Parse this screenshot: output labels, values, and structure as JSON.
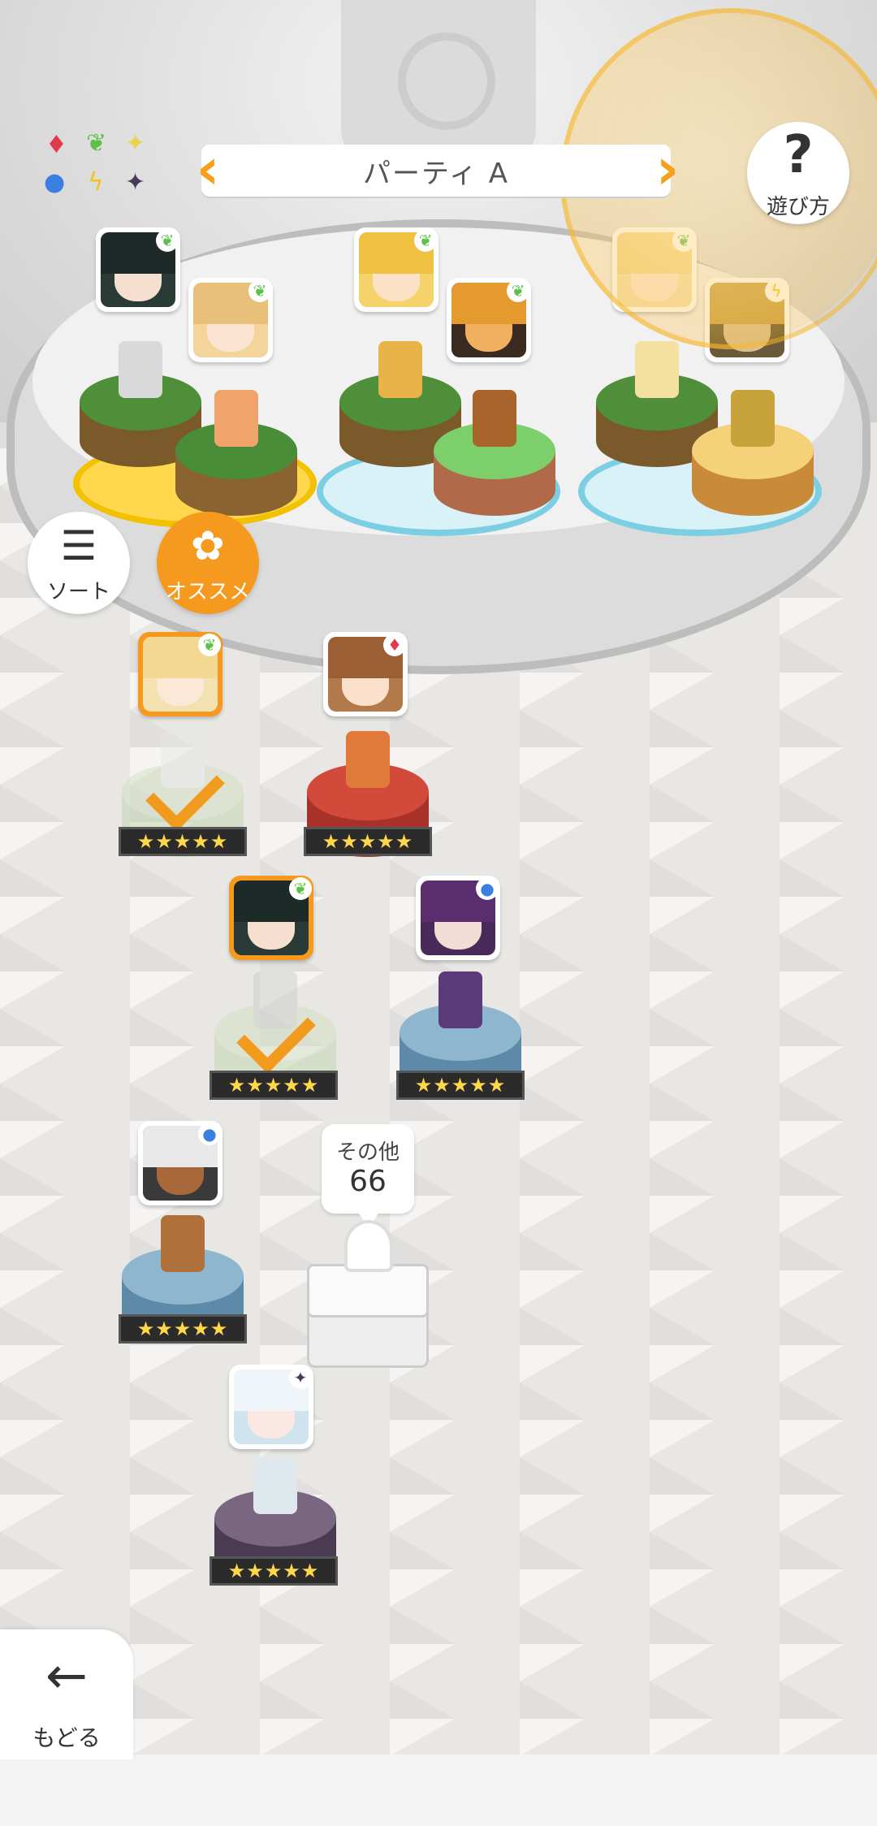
{
  "header": {
    "party_name": "パーティ A",
    "prev_icon": "chevron-left-icon",
    "next_icon": "chevron-right-icon",
    "help_label": "遊び方",
    "help_icon": "question-icon"
  },
  "attribute_chart": {
    "icons": [
      "fire-diamond",
      "wind-leaf",
      "light-sparkle",
      "water-circle",
      "thunder-bolt",
      "dark-star"
    ]
  },
  "side_buttons": {
    "sort_label": "ソート",
    "recommend_label": "オススメ"
  },
  "party_slots": [
    {
      "attrs": [
        "wind",
        "wind"
      ]
    },
    {
      "attrs": [
        "wind",
        "wind"
      ]
    },
    {
      "attrs": [
        "wind",
        "thunder"
      ]
    }
  ],
  "roster": [
    {
      "attr": "wind",
      "selected": true,
      "rarity": "★★★★★"
    },
    {
      "attr": "fire",
      "selected": false,
      "rarity": "★★★★★"
    },
    {
      "attr": "wind",
      "selected": true,
      "rarity": "★★★★★"
    },
    {
      "attr": "water",
      "selected": false,
      "rarity": "★★★★★"
    },
    {
      "attr": "water",
      "selected": false,
      "rarity": "★★★★★"
    },
    {
      "attr": "dark",
      "selected": false,
      "rarity": "★★★★★"
    }
  ],
  "others": {
    "label": "その他",
    "count": "66"
  },
  "back": {
    "label": "もどる",
    "icon": "arrow-left-icon"
  },
  "colors": {
    "accent": "#f59a1e",
    "fire": "#e23a4a",
    "wind": "#5cc04a",
    "light": "#e8d34a",
    "water": "#3b7fe0",
    "thunder": "#f5c21a",
    "dark": "#4a3a5a"
  }
}
